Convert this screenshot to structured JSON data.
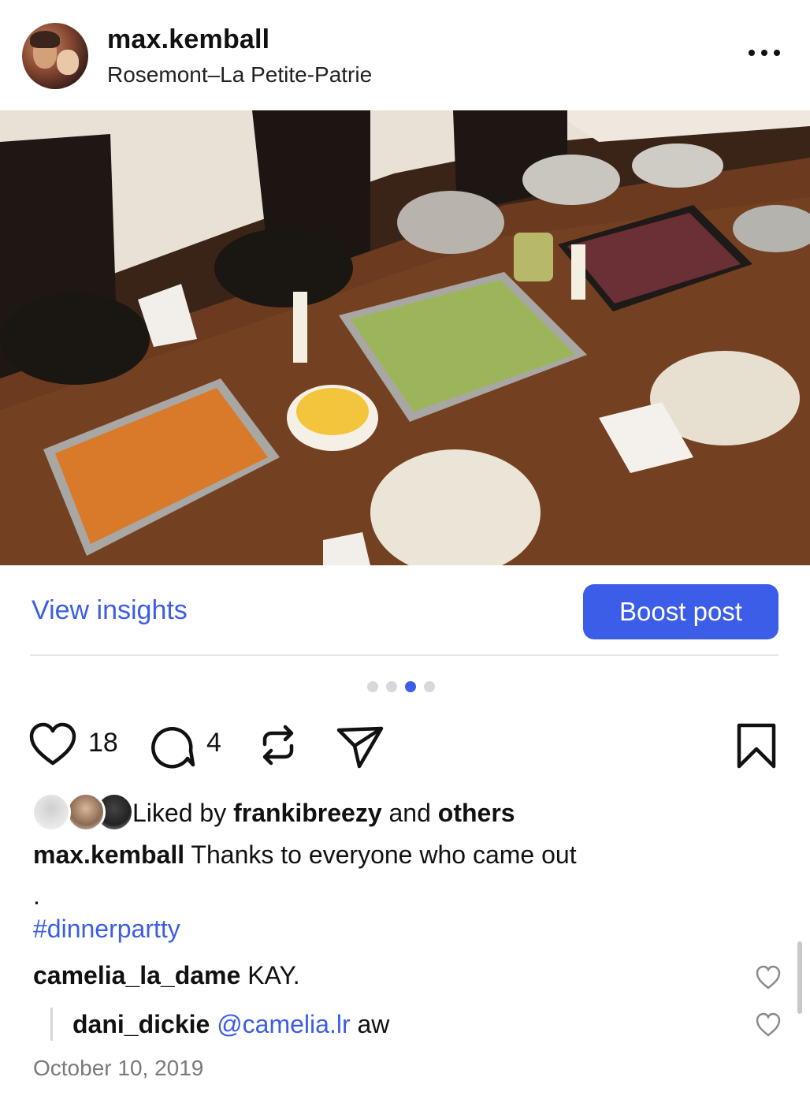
{
  "post": {
    "username": "max.kemball",
    "location": "Rosemont–La Petite-Patrie"
  },
  "actions": {
    "view_insights": "View insights",
    "boost_post": "Boost post"
  },
  "carousel": {
    "count": 4,
    "active_index": 2
  },
  "engagement": {
    "likes_count": "18",
    "comments_count": "4"
  },
  "likes": {
    "prefix": "Liked by ",
    "user": "frankibreezy",
    "middle": " and ",
    "others": "others"
  },
  "caption": {
    "username": "max.kemball",
    "text": " Thanks to everyone who came out",
    "dot": ".",
    "hashtag": "#dinnerpartty"
  },
  "comments": [
    {
      "username": "camelia_la_dame",
      "text": " KAY."
    }
  ],
  "reply": {
    "username": "dani_dickie",
    "mention": " @camelia.lr",
    "text": " aw"
  },
  "date": "October 10, 2019",
  "colors": {
    "accent": "#3b5de7",
    "secondary_text": "#7a7a7a"
  }
}
